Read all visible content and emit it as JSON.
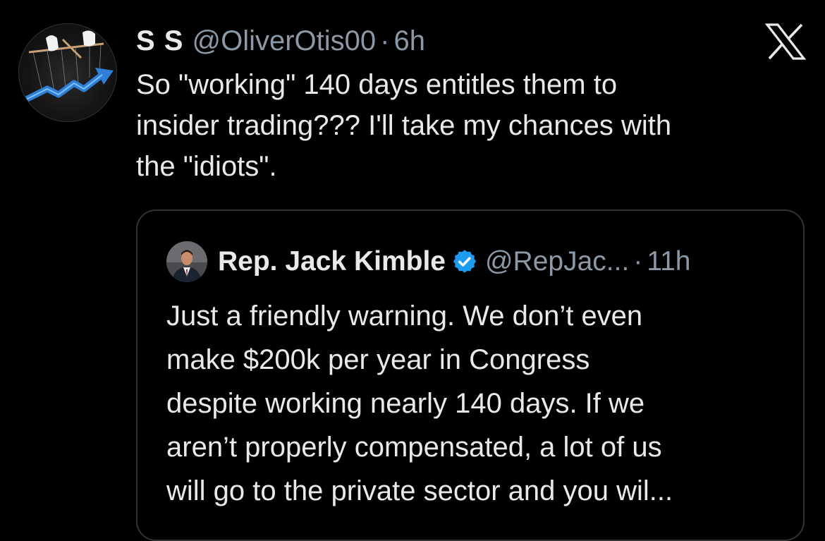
{
  "tweet": {
    "author": {
      "display_name": "S S",
      "handle": "@OliverOtis00",
      "avatar_icon": "puppet-strings-chart-icon"
    },
    "separator": "·",
    "time": "6h",
    "text_lines": [
      "So \"working\" 140 days entitles them to",
      "insider trading??? I'll take my chances with",
      "the \"idiots\"."
    ],
    "close_icon": "x-logo-icon"
  },
  "quote": {
    "author": {
      "display_name": "Rep. Jack Kimble",
      "verified_icon": "verified-badge-icon",
      "handle": "@RepJac...",
      "avatar_icon": "man-in-suit-avatar"
    },
    "separator": "·",
    "time": "11h",
    "text_lines": [
      "Just a friendly warning. We don’t even",
      "make $200k per year in Congress",
      "despite working nearly 140 days.  If we",
      "aren’t properly compensated, a lot of us",
      "will go to the private sector and you wil..."
    ]
  },
  "colors": {
    "background": "#000000",
    "primary_text": "#e7e9ea",
    "secondary_text": "#8b98a5",
    "border": "#2f3336",
    "verified_blue": "#1d9bf0"
  }
}
